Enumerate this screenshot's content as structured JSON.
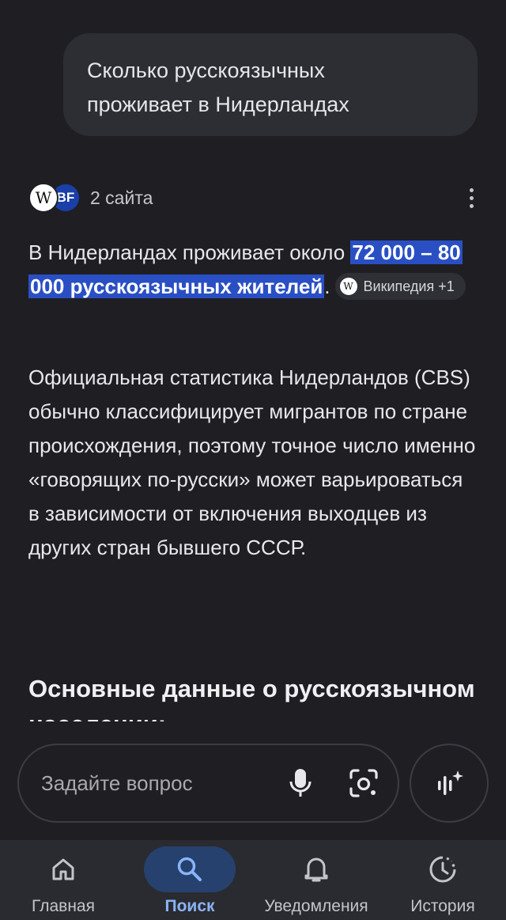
{
  "query": {
    "line1": "Сколько русскоязычных",
    "line2": "проживает в Нидерландах"
  },
  "sources": {
    "label": "2 сайта",
    "logo_wiki": "W",
    "logo_bf": "BF"
  },
  "answer": {
    "lead_prefix": "В Нидерландах проживает около ",
    "lead_highlight": "72 000 – 80 000 русскоязычных жителей",
    "lead_suffix": ".",
    "citation_chip": "Википедия +1",
    "citation_logo": "W",
    "body": "Официальная статистика Нидерландов (CBS) обычно классифицирует мигрантов по стране происхождения, поэтому точное число именно «говорящих по-русски» может варьироваться в зависимости от включения выходцев из других стран бывшего СССР.",
    "section_heading": "Основные данные о русскоязычном населении:"
  },
  "search": {
    "placeholder": "Задайте вопрос"
  },
  "nav": {
    "items": [
      {
        "label": "Главная",
        "icon": "home-icon"
      },
      {
        "label": "Поиск",
        "icon": "search-icon",
        "active": true
      },
      {
        "label": "Уведомления",
        "icon": "bell-icon"
      },
      {
        "label": "История",
        "icon": "history-icon"
      }
    ]
  },
  "colors": {
    "background": "#1f1f23",
    "highlight": "#2a4fc4",
    "active_nav": "#8ab4f8"
  }
}
